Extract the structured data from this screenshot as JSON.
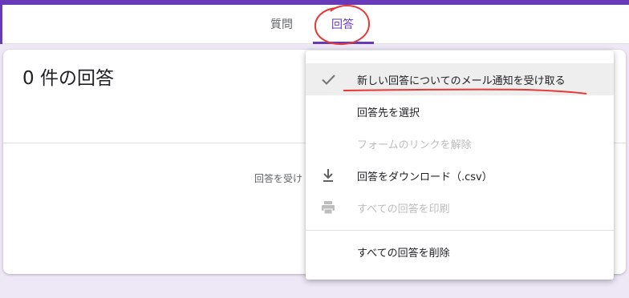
{
  "tabs": [
    {
      "label": "質問"
    },
    {
      "label": "回答"
    }
  ],
  "summary": {
    "response_count": "0 件の回答",
    "accepting_text": "回答を受け"
  },
  "menu": {
    "items": [
      {
        "label": "新しい回答についてのメール通知を受け取る",
        "checked": true,
        "icon": "check-icon"
      },
      {
        "label": "回答先を選択"
      },
      {
        "label": "フォームのリンクを解除",
        "disabled": true
      },
      {
        "label": "回答をダウンロード（.csv）",
        "icon": "download-icon"
      },
      {
        "label": "すべての回答を印刷",
        "disabled": true,
        "icon": "print-icon"
      },
      {
        "label": "すべての回答を削除"
      }
    ]
  },
  "colors": {
    "accent": "#673ab7",
    "background": "#ede7f6",
    "annotation": "#e53935"
  }
}
